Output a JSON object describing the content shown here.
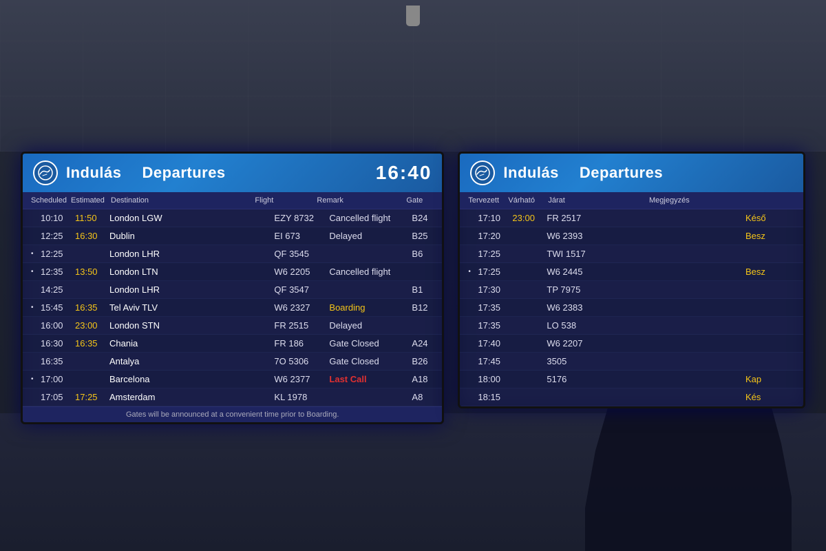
{
  "background": {
    "color": "#1a1f2e"
  },
  "board_left": {
    "logo_alt": "Lufthansa",
    "title_hu": "Indulás",
    "title_en": "Departures",
    "time": "16:40",
    "columns": [
      "Scheduled",
      "Estimated",
      "Destination",
      "Flight",
      "Remark",
      "Gate"
    ],
    "flights": [
      {
        "dot": "",
        "sched": "10:10",
        "est": "11:50",
        "dest": "London LGW",
        "flight": "EZY 8732",
        "remark": "Cancelled flight",
        "remark_type": "normal",
        "gate": "B24"
      },
      {
        "dot": "",
        "sched": "12:25",
        "est": "16:30",
        "dest": "Dublin",
        "flight": "EI 673",
        "remark": "Delayed",
        "remark_type": "normal",
        "gate": "B25"
      },
      {
        "dot": "•",
        "sched": "12:25",
        "est": "",
        "dest": "London LHR",
        "flight": "QF 3545",
        "remark": "",
        "remark_type": "normal",
        "gate": "B6"
      },
      {
        "dot": "•",
        "sched": "12:35",
        "est": "13:50",
        "dest": "London LTN",
        "flight": "W6 2205",
        "remark": "Cancelled flight",
        "remark_type": "normal",
        "gate": ""
      },
      {
        "dot": "",
        "sched": "14:25",
        "est": "",
        "dest": "London LHR",
        "flight": "QF 3547",
        "remark": "",
        "remark_type": "normal",
        "gate": "B1"
      },
      {
        "dot": "•",
        "sched": "15:45",
        "est": "16:35",
        "dest": "Tel Aviv TLV",
        "flight": "W6 2327",
        "remark": "Boarding",
        "remark_type": "boarding",
        "gate": "B12"
      },
      {
        "dot": "",
        "sched": "16:00",
        "est": "23:00",
        "dest": "London STN",
        "flight": "FR 2515",
        "remark": "Delayed",
        "remark_type": "normal",
        "gate": ""
      },
      {
        "dot": "",
        "sched": "16:30",
        "est": "16:35",
        "dest": "Chania",
        "flight": "FR 186",
        "remark": "Gate Closed",
        "remark_type": "normal",
        "gate": "A24"
      },
      {
        "dot": "",
        "sched": "16:35",
        "est": "",
        "dest": "Antalya",
        "flight": "7O 5306",
        "remark": "Gate Closed",
        "remark_type": "normal",
        "gate": "B26"
      },
      {
        "dot": "•",
        "sched": "17:00",
        "est": "",
        "dest": "Barcelona",
        "flight": "W6 2377",
        "remark": "Last Call",
        "remark_type": "lastcall",
        "gate": "A18"
      },
      {
        "dot": "",
        "sched": "17:05",
        "est": "17:25",
        "dest": "Amsterdam",
        "flight": "KL 1978",
        "remark": "",
        "remark_type": "normal",
        "gate": "A8"
      }
    ],
    "footer": "Gates will be announced at a convenient time prior to Boarding."
  },
  "board_right": {
    "logo_alt": "Lufthansa",
    "title_hu": "Indulás",
    "title_en": "Departures",
    "columns": [
      "Tervezett",
      "Várható",
      "Járat",
      "Megjegyzés"
    ],
    "flights": [
      {
        "dot": "",
        "sched": "17:10",
        "est": "23:00",
        "dest": "",
        "flight": "FR 2517",
        "remark": "Késő",
        "remark_type": "late"
      },
      {
        "dot": "",
        "sched": "17:20",
        "est": "",
        "dest": "",
        "flight": "W6 2393",
        "remark": "Besz",
        "remark_type": "best"
      },
      {
        "dot": "",
        "sched": "17:25",
        "est": "",
        "dest": "",
        "flight": "TWI 1517",
        "remark": "",
        "remark_type": "normal"
      },
      {
        "dot": "•",
        "sched": "17:25",
        "est": "",
        "dest": "",
        "flight": "W6 2445",
        "remark": "Besz",
        "remark_type": "best"
      },
      {
        "dot": "",
        "sched": "17:30",
        "est": "",
        "dest": "",
        "flight": "TP 7975",
        "remark": "",
        "remark_type": "normal"
      },
      {
        "dot": "",
        "sched": "17:35",
        "est": "",
        "dest": "",
        "flight": "W6 2383",
        "remark": "",
        "remark_type": "normal"
      },
      {
        "dot": "",
        "sched": "17:35",
        "est": "",
        "dest": "",
        "flight": "LO 538",
        "remark": "",
        "remark_type": "normal"
      },
      {
        "dot": "",
        "sched": "17:40",
        "est": "",
        "dest": "",
        "flight": "W6 2207",
        "remark": "",
        "remark_type": "normal"
      },
      {
        "dot": "",
        "sched": "17:45",
        "est": "",
        "dest": "",
        "flight": "3505",
        "remark": "",
        "remark_type": "normal"
      },
      {
        "dot": "",
        "sched": "18:00",
        "est": "",
        "dest": "",
        "flight": "5176",
        "remark": "Kap",
        "remark_type": "late"
      },
      {
        "dot": "",
        "sched": "18:15",
        "est": "",
        "dest": "",
        "flight": "",
        "remark": "Kés",
        "remark_type": "late"
      }
    ]
  }
}
